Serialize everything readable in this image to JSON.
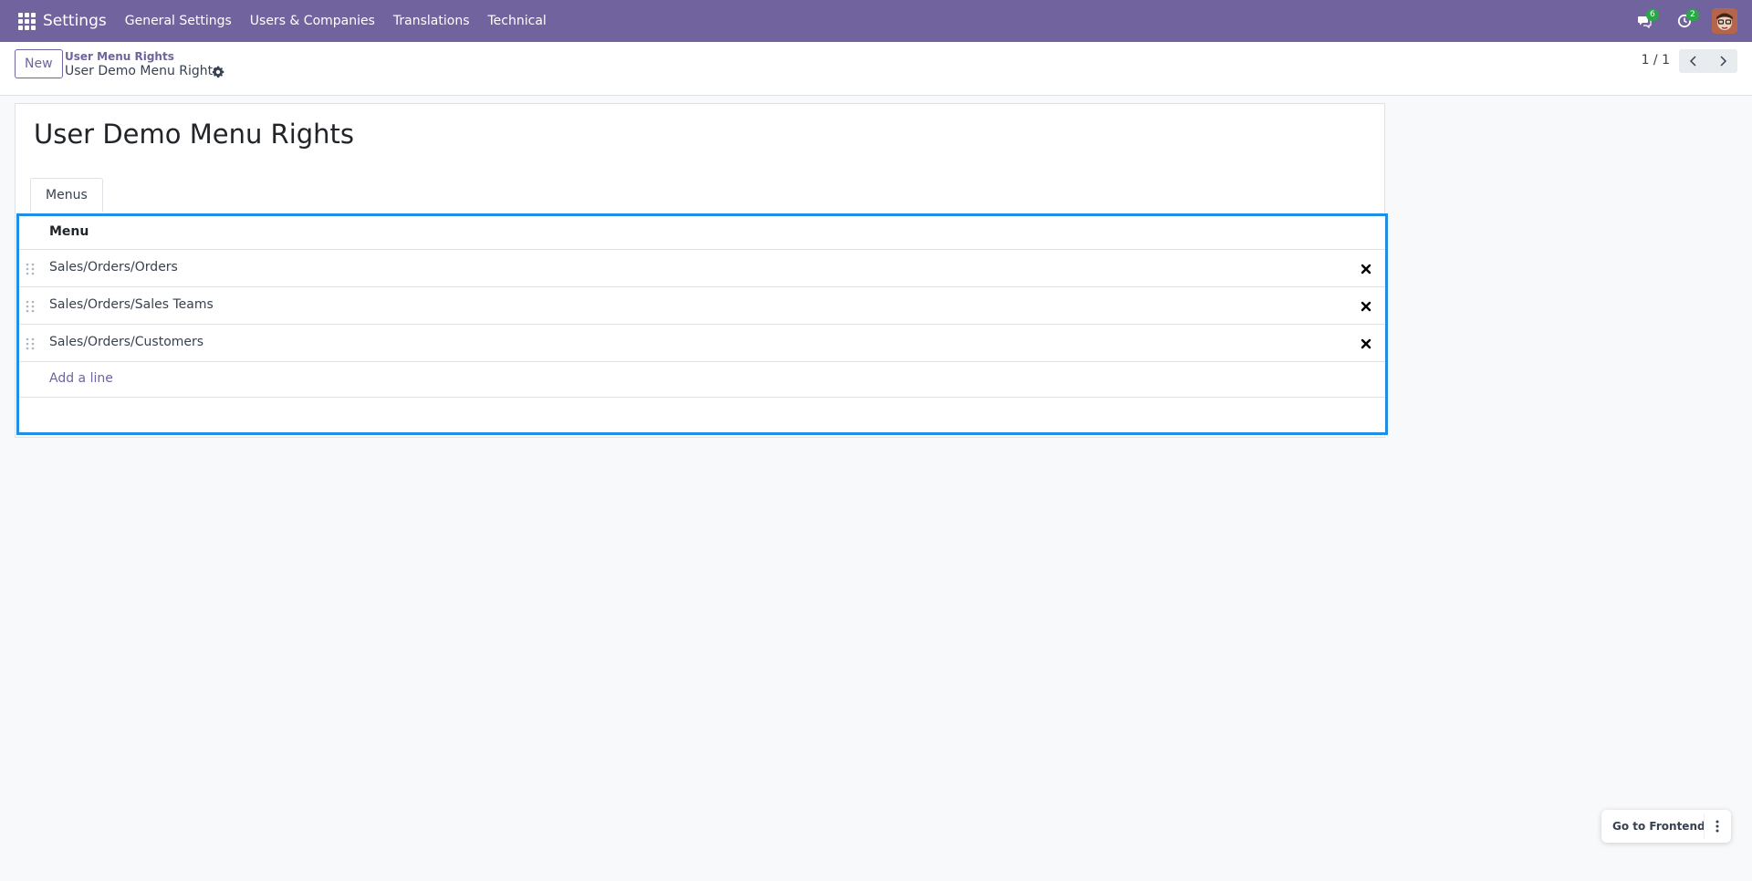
{
  "navbar": {
    "app_name": "Settings",
    "menus": [
      "General Settings",
      "Users & Companies",
      "Translations",
      "Technical"
    ],
    "messages_count": "6",
    "activities_count": "2",
    "color": "#71639e"
  },
  "control_panel": {
    "new_label": "New",
    "breadcrumb_parent": "User Menu Rights",
    "breadcrumb_current": "User Demo Menu Rights",
    "pager": "1 / 1"
  },
  "form": {
    "title": "User Demo Menu Rights",
    "tab_label": "Menus",
    "list": {
      "column_header": "Menu",
      "rows": [
        "Sales/Orders/Orders",
        "Sales/Orders/Sales Teams",
        "Sales/Orders/Customers"
      ],
      "add_line": "Add a line"
    }
  },
  "frontend": {
    "label": "Go to Frontend"
  },
  "icons": [
    "apps-grid-icon",
    "chat-icon",
    "clock-icon",
    "gear-icon",
    "chevron-left-icon",
    "chevron-right-icon",
    "drag-handle-icon",
    "delete-x-icon",
    "kebab-icon"
  ]
}
